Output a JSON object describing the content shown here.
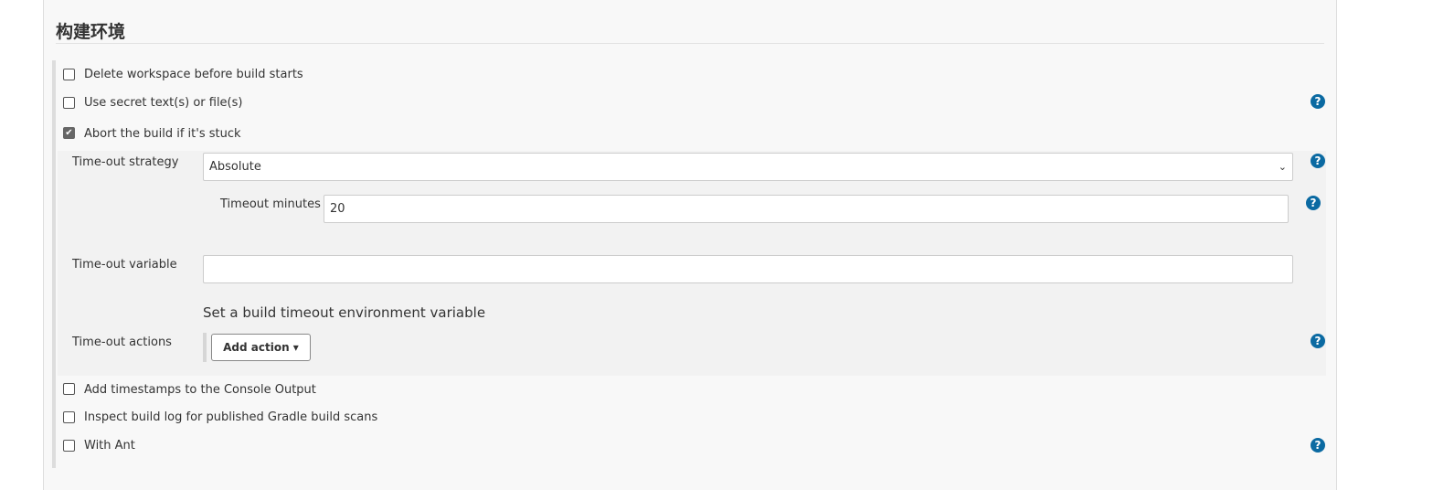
{
  "section_title": "构建环境",
  "options": {
    "delete_workspace": {
      "label": "Delete workspace before build starts",
      "checked": false
    },
    "secret_text": {
      "label": "Use secret text(s) or file(s)",
      "checked": false
    },
    "abort_stuck": {
      "label": "Abort the build if it's stuck",
      "checked": true
    },
    "timestamps": {
      "label": "Add timestamps to the Console Output",
      "checked": false
    },
    "gradle_scans": {
      "label": "Inspect build log for published Gradle build scans",
      "checked": false
    },
    "with_ant": {
      "label": "With Ant",
      "checked": false
    }
  },
  "timeout": {
    "strategy_label": "Time-out strategy",
    "strategy_value": "Absolute",
    "minutes_label": "Timeout minutes",
    "minutes_value": "20",
    "variable_label": "Time-out variable",
    "variable_value": "",
    "variable_description": "Set a build timeout environment variable",
    "actions_label": "Time-out actions",
    "add_action_label": "Add action ▾"
  },
  "help_icon": "?",
  "colors": {
    "help": "#0b6aa2"
  }
}
